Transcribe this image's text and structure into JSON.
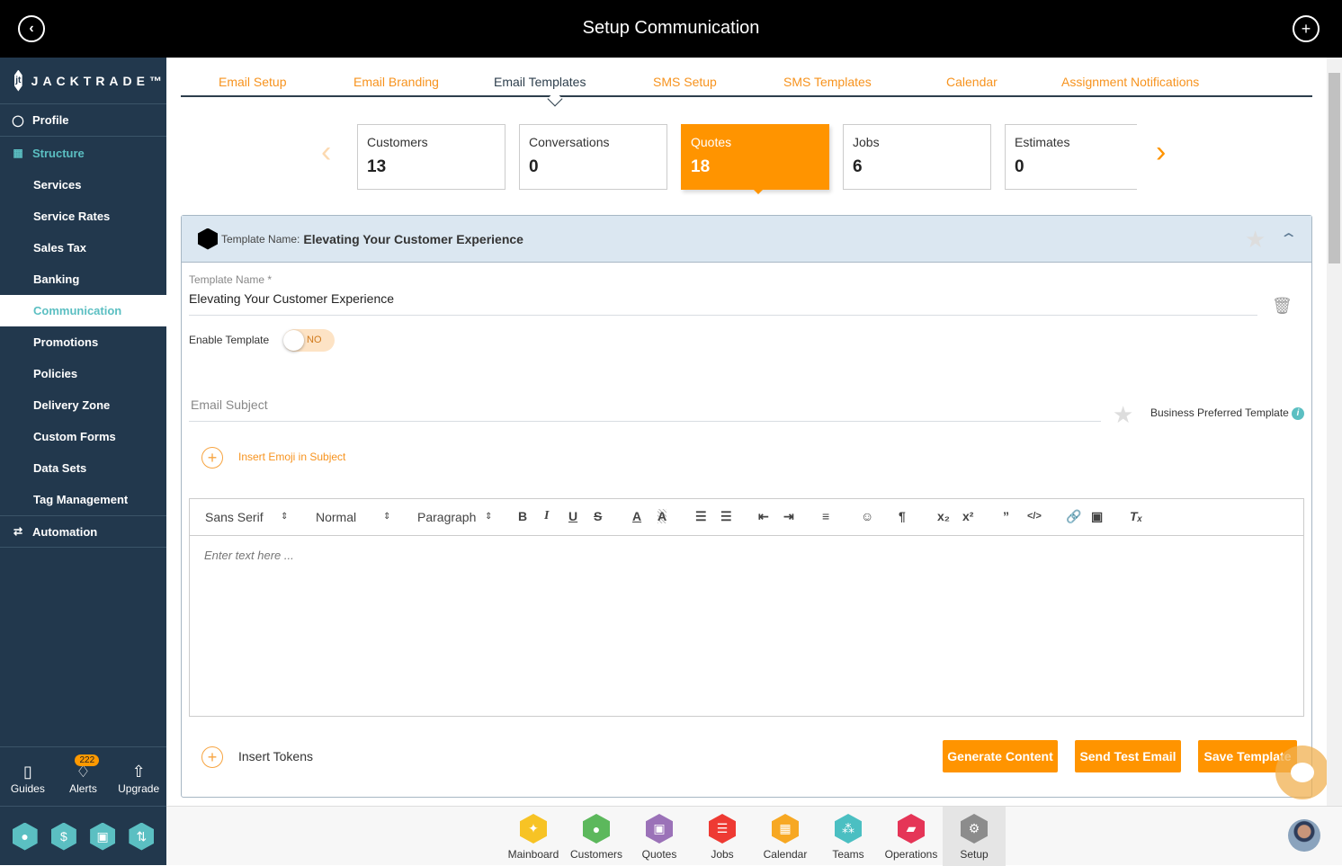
{
  "header": {
    "title": "Setup Communication",
    "back_icon": "back-circle-icon",
    "add_icon": "plus-circle-icon"
  },
  "sidebar": {
    "logo_text": "JACKTRADE™",
    "profile": "Profile",
    "structure": "Structure",
    "items": [
      "Services",
      "Service Rates",
      "Sales Tax",
      "Banking",
      "Communication",
      "Promotions",
      "Policies",
      "Delivery Zone",
      "Custom Forms",
      "Data Sets",
      "Tag Management"
    ],
    "active_item": "Communication",
    "automation": "Automation",
    "tools": {
      "guides": "Guides",
      "alerts": "Alerts",
      "alerts_count": "222",
      "upgrade": "Upgrade"
    }
  },
  "tabs": [
    "Email Setup",
    "Email Branding",
    "Email Templates",
    "SMS Setup",
    "SMS Templates",
    "Calendar",
    "Assignment Notifications"
  ],
  "active_tab": "Email Templates",
  "cards": [
    {
      "label": "Customers",
      "value": "13"
    },
    {
      "label": "Conversations",
      "value": "0"
    },
    {
      "label": "Quotes",
      "value": "18"
    },
    {
      "label": "Jobs",
      "value": "6"
    },
    {
      "label": "Estimates",
      "value": "0"
    }
  ],
  "active_card": "Quotes",
  "panel": {
    "head_key": "Template Name:",
    "head_value": "Elevating Your Customer Experience",
    "template_name_label": "Template Name *",
    "template_name_value": "Elevating Your Customer Experience",
    "enable_label": "Enable Template",
    "enable_state": "NO",
    "email_subject_placeholder": "Email Subject",
    "business_preferred": "Business Preferred Template",
    "insert_emoji": "Insert Emoji in Subject",
    "editor": {
      "font": "Sans Serif",
      "size": "Normal",
      "format": "Paragraph",
      "placeholder": "Enter text here ..."
    },
    "insert_tokens": "Insert Tokens",
    "buttons": {
      "generate": "Generate Content",
      "send_test": "Send Test Email",
      "save": "Save Template"
    }
  },
  "bottom_nav": [
    {
      "label": "Mainboard",
      "color": "#f7c325",
      "glyph": "✦"
    },
    {
      "label": "Customers",
      "color": "#5cb85c",
      "glyph": "●"
    },
    {
      "label": "Quotes",
      "color": "#9b72b8",
      "glyph": "▣"
    },
    {
      "label": "Jobs",
      "color": "#ee3a33",
      "glyph": "☰"
    },
    {
      "label": "Calendar",
      "color": "#f7a823",
      "glyph": "▦"
    },
    {
      "label": "Teams",
      "color": "#4bbfc2",
      "glyph": "⁂"
    },
    {
      "label": "Operations",
      "color": "#e53557",
      "glyph": "▰"
    },
    {
      "label": "Setup",
      "color": "#8c8c8c",
      "glyph": "⚙"
    }
  ],
  "active_bottom": "Setup",
  "colors": {
    "accent": "#ff9400",
    "sidebar_bg": "#22384d",
    "teal": "#5bbfc2"
  }
}
